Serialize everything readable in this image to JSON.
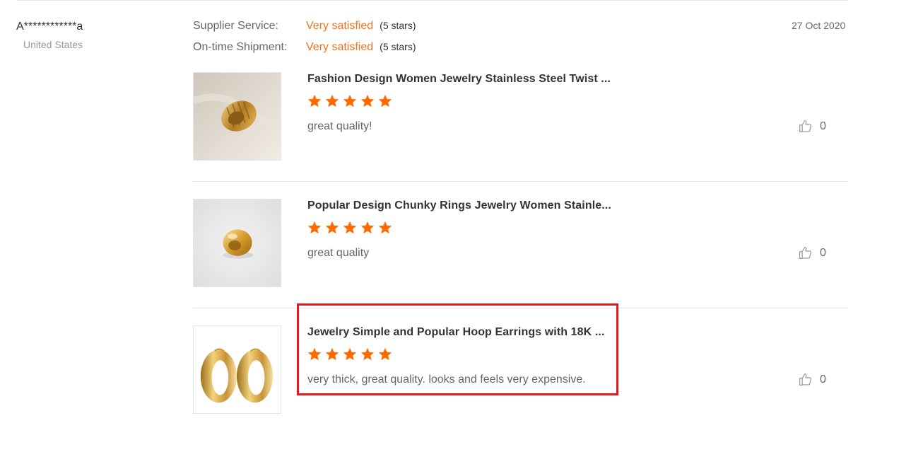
{
  "reviewer": {
    "name": "A************a",
    "country": "United States"
  },
  "ratings": [
    {
      "label": "Supplier Service:",
      "value": "Very satisfied",
      "stars_text": "(5 stars)"
    },
    {
      "label": "On-time Shipment:",
      "value": "Very satisfied",
      "stars_text": "(5 stars)"
    }
  ],
  "date": "27 Oct 2020",
  "reviews": [
    {
      "title": "Fashion Design Women Jewelry Stainless Steel Twist ...",
      "rating": 5,
      "text": "great quality!",
      "likes": "0",
      "thumb_icon": "twisted-gold-ring-image"
    },
    {
      "title": "Popular Design Chunky Rings Jewelry Women Stainle...",
      "rating": 5,
      "text": "great quality",
      "likes": "0",
      "thumb_icon": "chunky-gold-ring-image"
    },
    {
      "title": "Jewelry Simple and Popular Hoop Earrings with 18K ...",
      "rating": 5,
      "text": "very thick, great quality. looks and feels very expensive.",
      "likes": "0",
      "thumb_icon": "gold-hoop-earrings-image"
    }
  ],
  "colors": {
    "accent": "#f0731e",
    "star": "#ff6a00",
    "highlight": "#e31b1b"
  },
  "icons": {
    "star": "star-icon",
    "like": "thumbs-up-icon"
  }
}
